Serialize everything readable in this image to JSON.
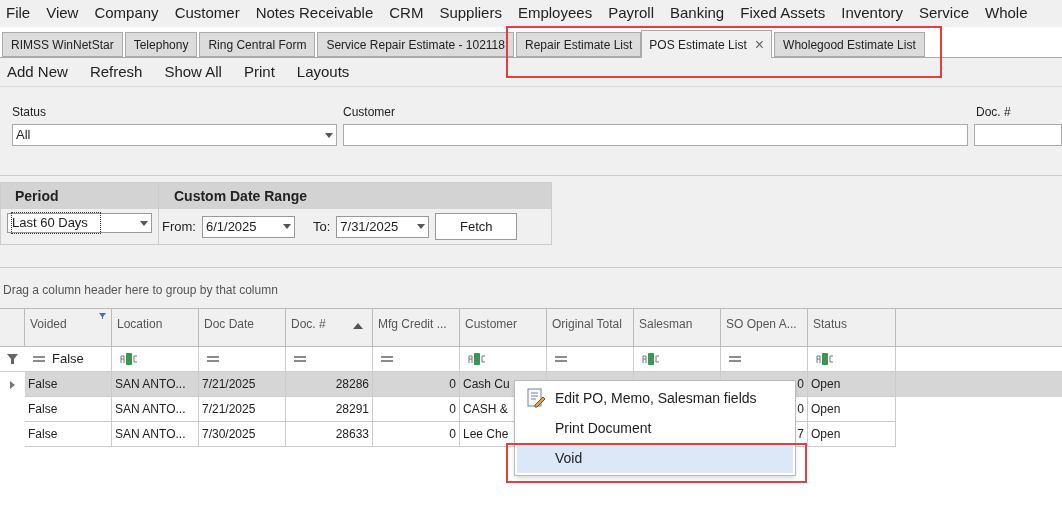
{
  "menu_bar": [
    "File",
    "View",
    "Company",
    "Customer",
    "Notes Receivable",
    "CRM",
    "Suppliers",
    "Employees",
    "Payroll",
    "Banking",
    "Fixed Assets",
    "Inventory",
    "Service",
    "Whole"
  ],
  "tabs": [
    {
      "label": "RIMSS WinNetStar",
      "selected": false
    },
    {
      "label": "Telephony",
      "selected": false
    },
    {
      "label": "Ring Central Form",
      "selected": false
    },
    {
      "label": "Service Repair Estimate - 102118",
      "selected": false
    },
    {
      "label": "Repair Estimate List",
      "selected": false
    },
    {
      "label": "POS Estimate List",
      "selected": true,
      "close": "×"
    },
    {
      "label": "Wholegood Estimate List",
      "selected": false
    }
  ],
  "toolbar": [
    "Add New",
    "Refresh",
    "Show All",
    "Print",
    "Layouts"
  ],
  "filters": {
    "status": {
      "label": "Status",
      "value": "All"
    },
    "customer": {
      "label": "Customer"
    },
    "doc": {
      "label": "Doc. #"
    }
  },
  "period": {
    "title": "Period",
    "value": "Last 60 Days"
  },
  "date_range": {
    "title": "Custom Date Range",
    "from_label": "From:",
    "from": "6/1/2025",
    "to_label": "To:",
    "to": "7/31/2025",
    "button": "Fetch"
  },
  "group_panel": "Drag a column header here to group by that column",
  "table": {
    "columns": [
      {
        "label": "Voided",
        "kind": "boolean",
        "filter_value": "False",
        "filtered": true,
        "sorted": false
      },
      {
        "label": "Location",
        "kind": "text",
        "filtered": false,
        "sorted": false
      },
      {
        "label": "Doc Date",
        "kind": "date",
        "filtered": false,
        "sorted": false
      },
      {
        "label": "Doc. #",
        "kind": "number",
        "filtered": false,
        "sorted": true
      },
      {
        "label": "Mfg Credit ...",
        "kind": "number",
        "filtered": false,
        "sorted": false
      },
      {
        "label": "Customer",
        "kind": "text",
        "filtered": false,
        "sorted": false
      },
      {
        "label": "Original Total",
        "kind": "number",
        "filtered": false,
        "sorted": false
      },
      {
        "label": "Salesman",
        "kind": "text",
        "filtered": false,
        "sorted": false
      },
      {
        "label": "SO Open A...",
        "kind": "number",
        "filtered": false,
        "sorted": false
      },
      {
        "label": "Status",
        "kind": "text",
        "filtered": false,
        "sorted": false
      }
    ],
    "rows": [
      {
        "selected": true,
        "cells": [
          "False",
          "SAN ANTO...",
          "7/21/2025",
          "28286",
          "0",
          "Cash Cu",
          "",
          "",
          "0",
          "Open"
        ]
      },
      {
        "selected": false,
        "cells": [
          "False",
          "SAN ANTO...",
          "7/21/2025",
          "28291",
          "0",
          "CASH &",
          "",
          "",
          "0",
          "Open"
        ]
      },
      {
        "selected": false,
        "cells": [
          "False",
          "SAN ANTO...",
          "7/30/2025",
          "28633",
          "0",
          "Lee Che",
          "",
          "",
          "7",
          "Open"
        ]
      }
    ]
  },
  "context_menu": [
    {
      "label": "Edit PO, Memo, Salesman fields",
      "icon": true,
      "selected": false
    },
    {
      "label": "Print Document",
      "icon": false,
      "selected": false
    },
    {
      "label": "Void",
      "icon": false,
      "selected": true
    }
  ]
}
